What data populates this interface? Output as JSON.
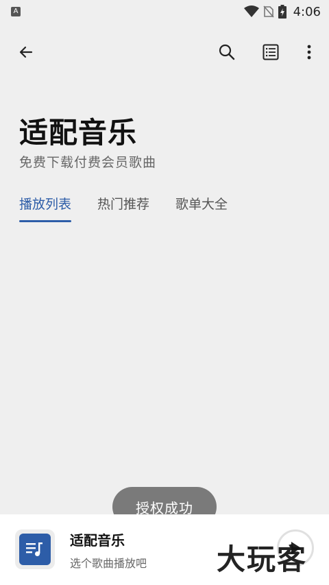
{
  "status_bar": {
    "time": "4:06",
    "app_indicator": "A"
  },
  "app_bar": {
    "back_icon": "arrow-back-icon",
    "search_icon": "search-icon",
    "list_icon": "list-icon",
    "more_icon": "more-vert-icon"
  },
  "header": {
    "title": "适配音乐",
    "subtitle": "免费下载付费会员歌曲"
  },
  "tabs": [
    {
      "label": "播放列表",
      "active": true
    },
    {
      "label": "热门推荐",
      "active": false
    },
    {
      "label": "歌单大全",
      "active": false
    }
  ],
  "toast": {
    "message": "授权成功"
  },
  "player": {
    "title": "适配音乐",
    "subtitle": "选个歌曲播放吧",
    "cover_icon": "playlist-music-icon",
    "play_icon": "play-icon"
  },
  "watermark": {
    "text": "大玩客"
  },
  "colors": {
    "accent": "#2d5da8",
    "background": "#efefef",
    "toast": "#7a7a7a"
  }
}
